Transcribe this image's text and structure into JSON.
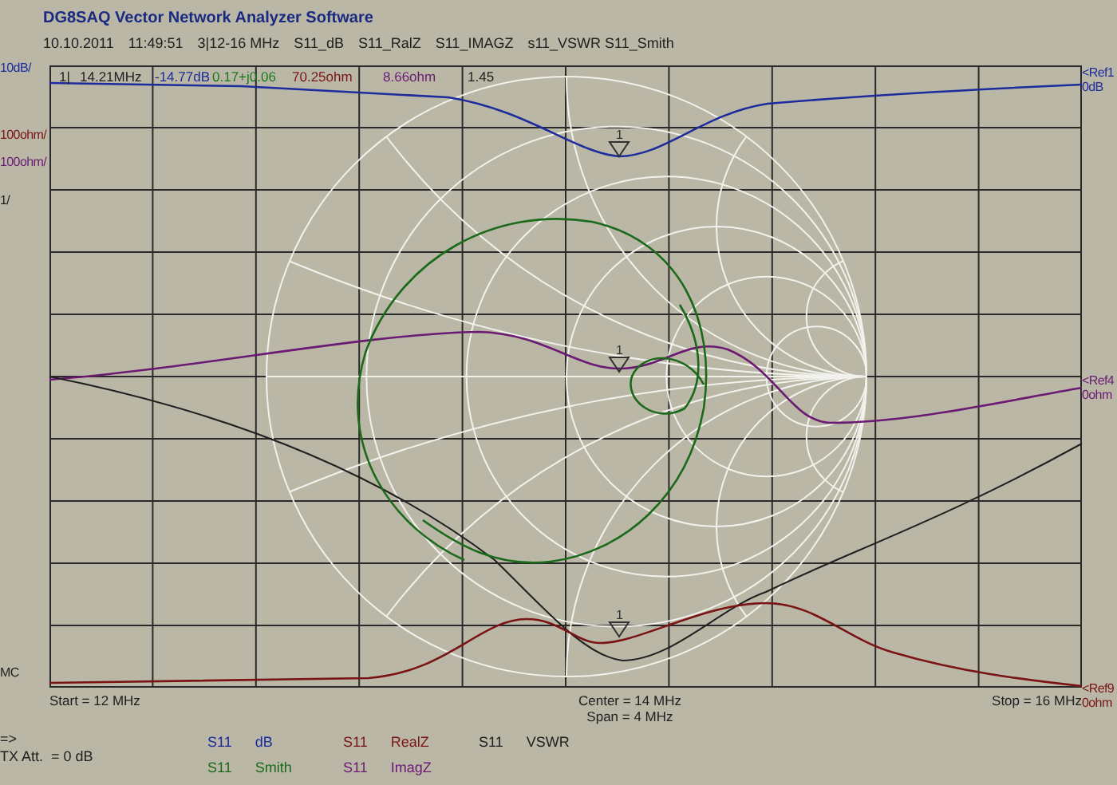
{
  "header": {
    "title": "DG8SAQ Vector Network Analyzer Software",
    "info": [
      "10.10.2011",
      "11:49:51",
      "3|12-16 MHz",
      "S11_dB",
      "S11_RalZ",
      "S11_IMAGZ",
      "s11_VSWR S11_Smith"
    ]
  },
  "scales": [
    {
      "text": "10dB/",
      "color": "#1c2c9c"
    },
    {
      "text": "100ohm/",
      "color": "#7a1414"
    },
    {
      "text": "100ohm/",
      "color": "#6a1a72"
    },
    {
      "text": "1/",
      "color": "#202020"
    },
    {
      "text": "MC",
      "color": "#202020"
    }
  ],
  "marker_readout": [
    {
      "text": "1|",
      "color": "#202020"
    },
    {
      "text": "14.21MHz",
      "color": "#202020"
    },
    {
      "text": "-14.77dB",
      "color": "#1c2c9c"
    },
    {
      "text": "0.17+j0.06",
      "color": "#1a7a1a"
    },
    {
      "text": "70.25ohm",
      "color": "#7a1414"
    },
    {
      "text": "8.66ohm",
      "color": "#6a1a72"
    },
    {
      "text": "1.45",
      "color": "#202020"
    }
  ],
  "marker_labels": [
    "1",
    "1",
    "1"
  ],
  "references": [
    {
      "label": "<Ref1",
      "value": "0dB",
      "color": "#1c2c9c"
    },
    {
      "label": "<Ref4",
      "value": "0ohm",
      "color": "#6a1a72"
    },
    {
      "label": "<Ref9",
      "value": "0ohm",
      "color": "#7a1414"
    }
  ],
  "sweep": {
    "start": "Start = 12 MHz",
    "center": "Center = 14 MHz",
    "span": "Span = 4 MHz",
    "stop": "Stop = 16 MHz"
  },
  "tx": {
    "arrow": "=>",
    "attenuation": "TX Att.  = 0 dB"
  },
  "legend": [
    {
      "param": "S11",
      "name": "dB",
      "color": "#1c2c9c"
    },
    {
      "param": "S11",
      "name": "Smith",
      "color": "#1a6a1a"
    },
    {
      "param": "S11",
      "name": "RealZ",
      "color": "#7a1414"
    },
    {
      "param": "S11",
      "name": "ImagZ",
      "color": "#6a1a72"
    },
    {
      "param": "S11",
      "name": "VSWR",
      "color": "#202020"
    }
  ]
}
